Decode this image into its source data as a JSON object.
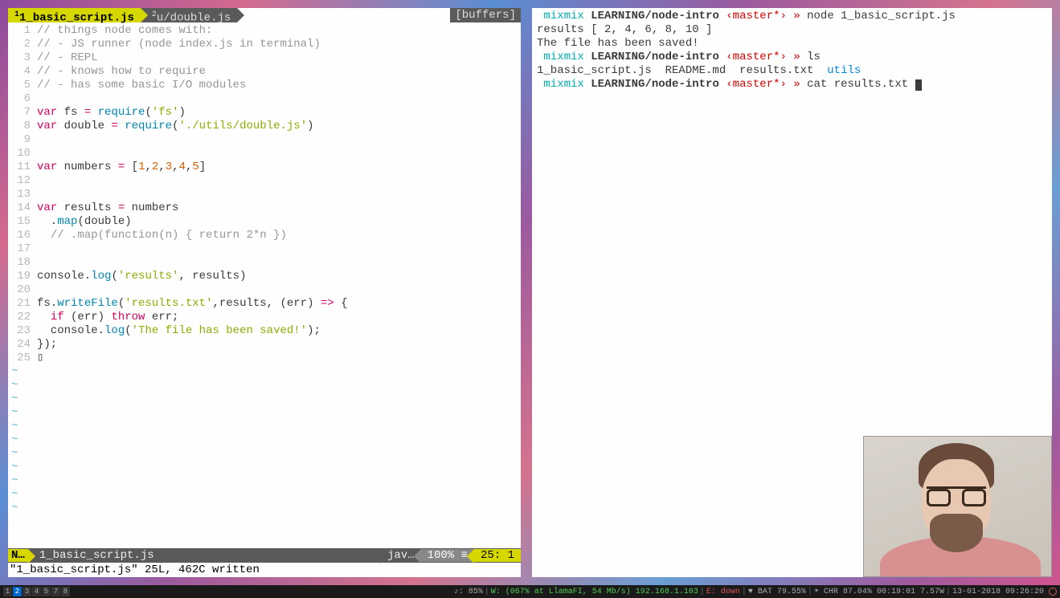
{
  "editor": {
    "tabs": [
      {
        "index": "1",
        "label": "1_basic_script.js",
        "active": true
      },
      {
        "index": "2",
        "label": "u/double.js",
        "active": false
      }
    ],
    "buffers_label": "[buffers]",
    "lines": [
      {
        "n": 1,
        "html": "<span class='c-comment'>// things node comes with:</span>"
      },
      {
        "n": 2,
        "html": "<span class='c-comment'>// - JS runner (node index.js in terminal)</span>"
      },
      {
        "n": 3,
        "html": "<span class='c-comment'>// - REPL</span>"
      },
      {
        "n": 4,
        "html": "<span class='c-comment'>// - knows how to require</span>"
      },
      {
        "n": 5,
        "html": "<span class='c-comment'>// - has some basic I/O modules</span>"
      },
      {
        "n": 6,
        "html": ""
      },
      {
        "n": 7,
        "html": "<span class='c-keyword'>var</span> fs <span class='c-keyword'>=</span> <span class='c-func'>require</span>(<span class='c-string'>'fs'</span>)"
      },
      {
        "n": 8,
        "html": "<span class='c-keyword'>var</span> double <span class='c-keyword'>=</span> <span class='c-func'>require</span>(<span class='c-string'>'./utils/double.js'</span>)"
      },
      {
        "n": 9,
        "html": ""
      },
      {
        "n": 10,
        "html": ""
      },
      {
        "n": 11,
        "html": "<span class='c-keyword'>var</span> numbers <span class='c-keyword'>=</span> [<span class='c-number'>1</span>,<span class='c-number'>2</span>,<span class='c-number'>3</span>,<span class='c-number'>4</span>,<span class='c-number'>5</span>]"
      },
      {
        "n": 12,
        "html": ""
      },
      {
        "n": 13,
        "html": ""
      },
      {
        "n": 14,
        "html": "<span class='c-keyword'>var</span> results <span class='c-keyword'>=</span> numbers"
      },
      {
        "n": 15,
        "html": "  .<span class='c-func'>map</span>(double)"
      },
      {
        "n": 16,
        "html": "  <span class='c-comment'>// .map(function(n) { return 2*n })</span>"
      },
      {
        "n": 17,
        "html": ""
      },
      {
        "n": 18,
        "html": ""
      },
      {
        "n": 19,
        "html": "console.<span class='c-func'>log</span>(<span class='c-string'>'results'</span>, results)"
      },
      {
        "n": 20,
        "html": ""
      },
      {
        "n": 21,
        "html": "fs.<span class='c-func'>writeFile</span>(<span class='c-string'>'results.txt'</span>,results, (err) <span class='c-keyword'>=&gt;</span> {"
      },
      {
        "n": 22,
        "html": "  <span class='c-keyword'>if</span> (err) <span class='c-keyword'>throw</span> err;"
      },
      {
        "n": 23,
        "html": "  console.<span class='c-func'>log</span>(<span class='c-string'>'The file has been saved!'</span>);"
      },
      {
        "n": 24,
        "html": "});"
      },
      {
        "n": 25,
        "html": "▯"
      }
    ],
    "tilde_count": 11,
    "status": {
      "mode": "N…",
      "file": "1_basic_script.js",
      "lang": "jav…",
      "percent": "100% ≡",
      "pos": "25:  1"
    },
    "cmdline": "\"1_basic_script.js\" 25L, 462C written"
  },
  "terminal": {
    "lines": [
      {
        "html": " <span class='t-user'>mixmix</span> <span class='t-path'>LEARNING/node-intro</span> <span class='t-branch'>‹master*›</span> <span class='t-prompt'>»</span> node 1_basic_script.js"
      },
      {
        "html": "results [ 2, 4, 6, 8, 10 ]"
      },
      {
        "html": "The file has been saved!"
      },
      {
        "html": " <span class='t-user'>mixmix</span> <span class='t-path'>LEARNING/node-intro</span> <span class='t-branch'>‹master*›</span> <span class='t-prompt'>»</span> ls"
      },
      {
        "html": "1_basic_script.js  README.md  results.txt  <span class='t-dir'>utils</span>"
      },
      {
        "html": " <span class='t-user'>mixmix</span> <span class='t-path'>LEARNING/node-intro</span> <span class='t-branch'>‹master*›</span> <span class='t-prompt'>»</span> cat results.txt <span class='cursor-block'></span>"
      }
    ]
  },
  "osbar": {
    "workspaces": [
      "1",
      "2",
      "3",
      "4",
      "5",
      "7",
      "8"
    ],
    "active_ws": "2",
    "right": {
      "vol": "♪: 85%",
      "wifi": "W: (067% at LlamaFI, 54 Mb/s) 192.168.1.103",
      "eth": "E: down",
      "bat": "♥ BAT 79.55%",
      "chr": "☀ CHR 87.04% 00:19:01 7.57W",
      "date": "13-01-2018 09:26:20"
    }
  }
}
